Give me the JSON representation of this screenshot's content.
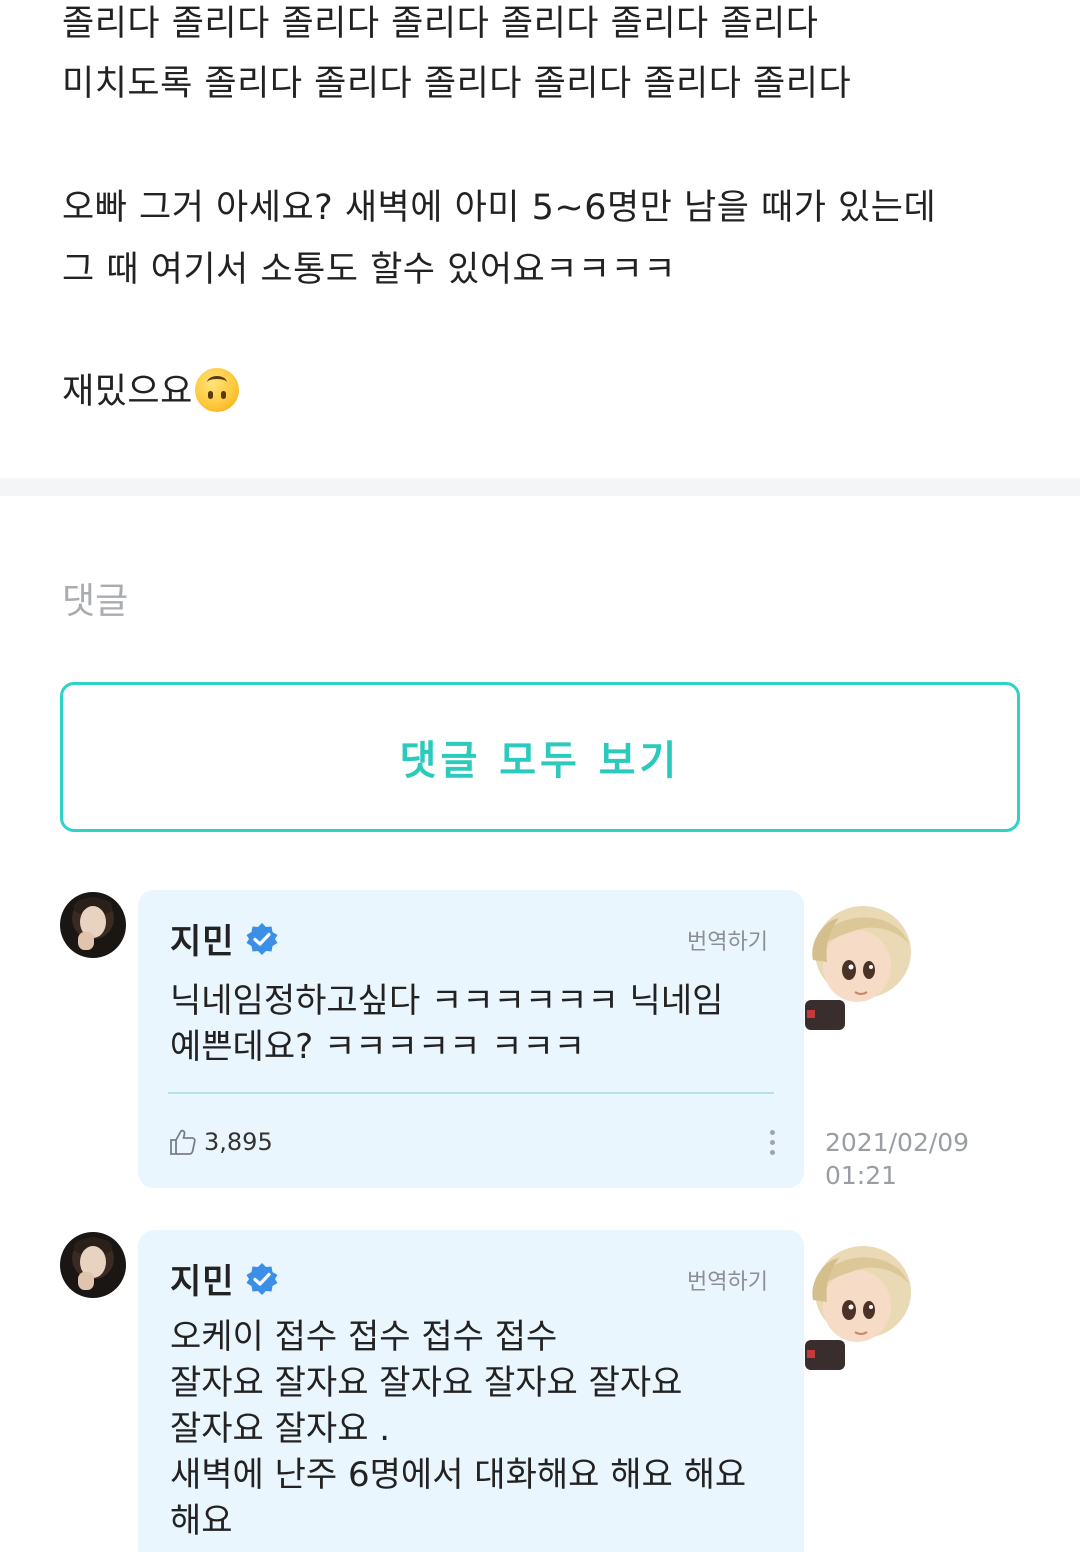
{
  "post": {
    "line1": "졸리다 졸리다 졸리다 졸리다 졸리다 졸리다 졸리다",
    "line2": "미치도록 졸리다 졸리다 졸리다 졸리다 졸리다 졸리다",
    "line3": "오빠 그거 아세요? 새벽에 아미 5~6명만 남을 때가 있는데",
    "line4": "그 때 여기서 소통도 할수 있어요ㅋㅋㅋㅋ",
    "line5": "재밌으요",
    "emoji_icon": "upside-down-face-emoji"
  },
  "comments_section": {
    "heading": "댓글",
    "view_all_label": "댓글 모두 보기",
    "accent_color": "#2ed3c6"
  },
  "comments": [
    {
      "author": "지민",
      "verified": true,
      "translate_label": "번역하기",
      "text_lines": [
        "닉네임정하고싶다 ㅋㅋㅋㅋㅋㅋ 닉네임",
        "예쁜데요? ㅋㅋㅋㅋㅋ ㅋㅋㅋ"
      ],
      "likes": "3,895",
      "date": "2021/02/09",
      "time": "01:21"
    },
    {
      "author": "지민",
      "verified": true,
      "translate_label": "번역하기",
      "text_lines": [
        "오케이 접수 접수 접수 접수",
        "잘자요 잘자요 잘자요 잘자요 잘자요",
        "잘자요 잘자요 .",
        "새벽에 난주 6명에서 대화해요 해요 해요",
        "해요"
      ]
    }
  ]
}
